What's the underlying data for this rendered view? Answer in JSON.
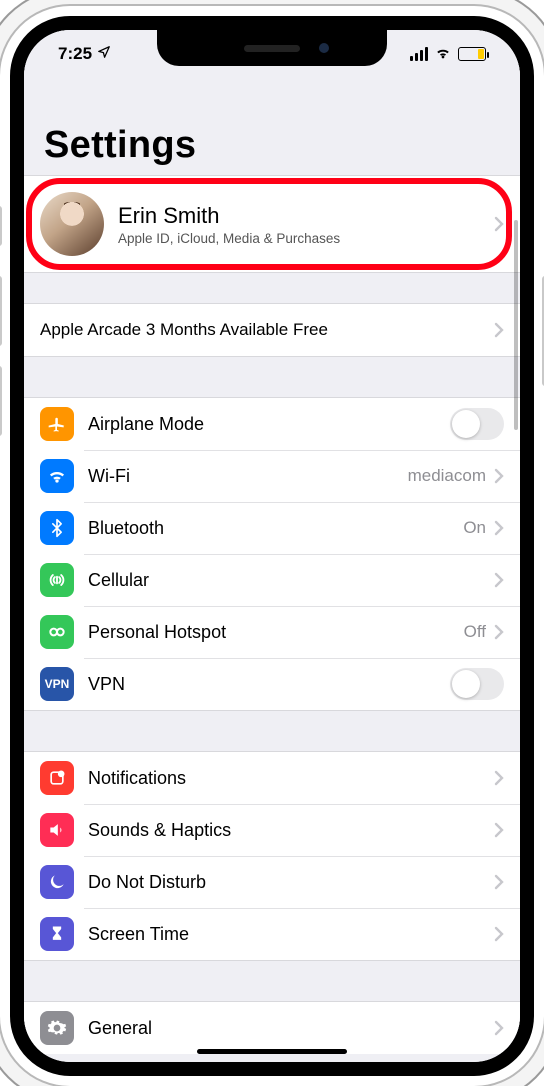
{
  "status": {
    "time": "7:25"
  },
  "title": "Settings",
  "highlight": "apple-id-row",
  "profile": {
    "name": "Erin Smith",
    "subtitle": "Apple ID, iCloud, Media & Purchases"
  },
  "promo": {
    "text": "Apple Arcade 3 Months Available Free"
  },
  "network": {
    "airplane": {
      "label": "Airplane Mode",
      "on": false
    },
    "wifi": {
      "label": "Wi-Fi",
      "value": "mediacom"
    },
    "bluetooth": {
      "label": "Bluetooth",
      "value": "On"
    },
    "cellular": {
      "label": "Cellular"
    },
    "hotspot": {
      "label": "Personal Hotspot",
      "value": "Off"
    },
    "vpn": {
      "label": "VPN",
      "on": false
    }
  },
  "alerts": {
    "notifications": {
      "label": "Notifications"
    },
    "sounds": {
      "label": "Sounds & Haptics"
    },
    "dnd": {
      "label": "Do Not Disturb"
    },
    "screentime": {
      "label": "Screen Time"
    }
  },
  "system": {
    "general": {
      "label": "General"
    }
  }
}
